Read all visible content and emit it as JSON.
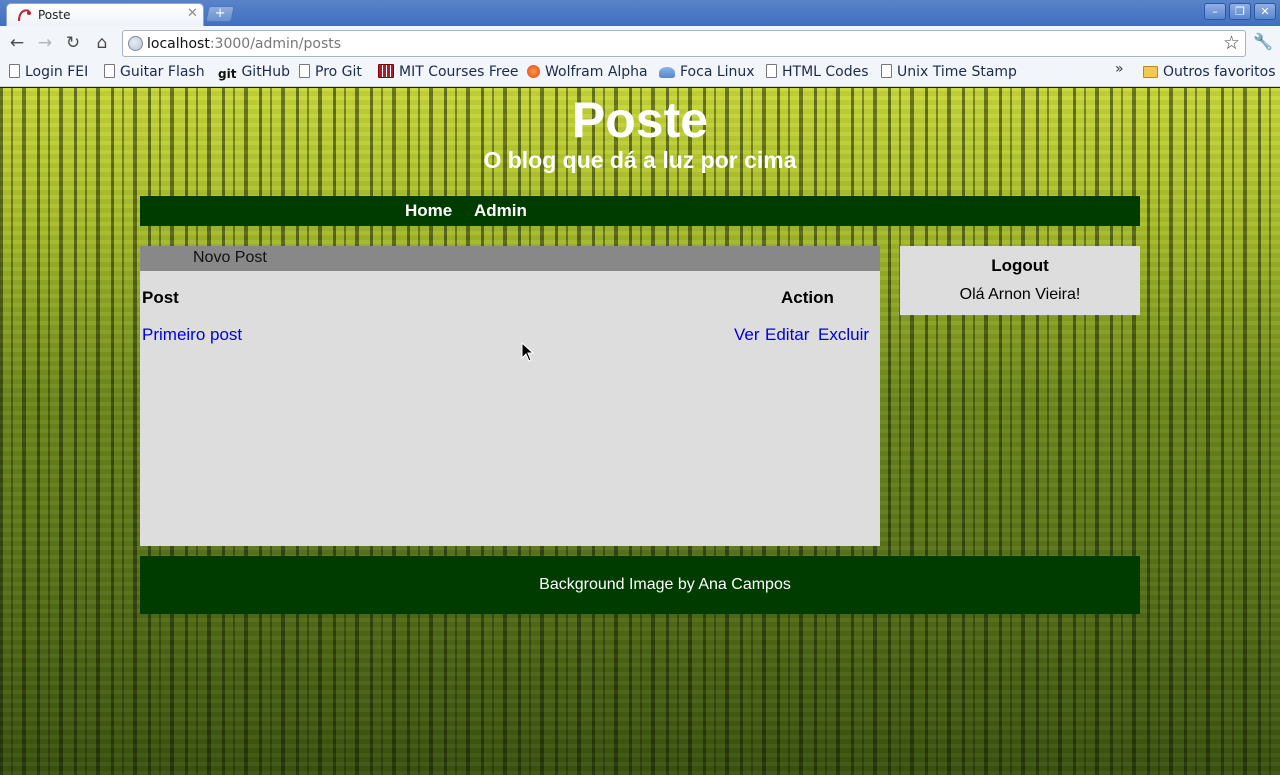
{
  "browser": {
    "tab_title": "Poste",
    "url_host": "localhost",
    "url_path": ":3000/admin/posts",
    "bookmarks": [
      {
        "label": "Login FEI",
        "icon": "page-icon"
      },
      {
        "label": "Guitar Flash",
        "icon": "page-icon"
      },
      {
        "label": "GitHub",
        "icon": "git-icon"
      },
      {
        "label": "Pro Git",
        "icon": "page-icon"
      },
      {
        "label": "MIT Courses Free",
        "icon": "mit-icon"
      },
      {
        "label": "Wolfram Alpha",
        "icon": "wolfram-icon"
      },
      {
        "label": "Foca Linux",
        "icon": "foca-icon"
      },
      {
        "label": "HTML Codes",
        "icon": "page-icon"
      },
      {
        "label": "Unix Time Stamp",
        "icon": "page-icon"
      }
    ],
    "other_bookmarks": "Outros favoritos",
    "more_bookmarks": "»"
  },
  "site": {
    "title": "Poste",
    "subtitle": "O blog que dá a luz por cima",
    "nav": [
      "Home",
      "Admin"
    ]
  },
  "content": {
    "new_post": "Novo Post",
    "headers": {
      "post": "Post",
      "action": "Action"
    },
    "rows": [
      {
        "title": "Primeiro post",
        "actions": [
          "Ver",
          "Editar",
          "Excluir"
        ]
      }
    ]
  },
  "sidebar": {
    "logout": "Logout",
    "greeting": "Olá Arnon Vieira!"
  },
  "footer": {
    "text": "Background Image by Ana Campos"
  },
  "colors": {
    "nav_bg": "#003c00",
    "panel_bg": "#dddddd",
    "content_bar": "#888888",
    "link": "#0000dd"
  }
}
